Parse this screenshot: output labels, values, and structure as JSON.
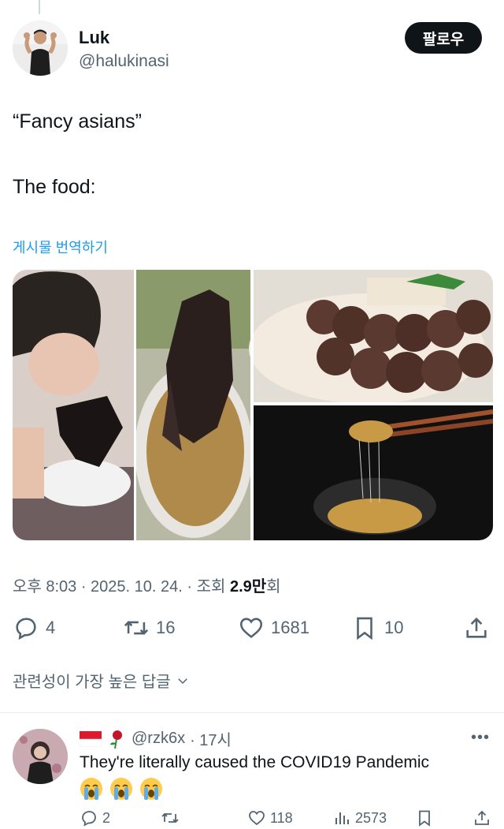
{
  "author": {
    "name": "Luk",
    "handle": "@halukinasi",
    "follow_label": "팔로우"
  },
  "tweet": {
    "line1": "“Fancy asians”",
    "line2": "The food:",
    "translate_label": "게시물 번역하기"
  },
  "meta": {
    "time_date": "오후 8:03 · 2025. 10. 24. · 조회 ",
    "views_count": "2.9만",
    "views_suffix": "회"
  },
  "actions": {
    "replies": "4",
    "reposts": "16",
    "likes": "1681",
    "bookmarks": "10"
  },
  "sort_label": "관련성이 가장 높은 답글",
  "reply": {
    "handle": "@rzk6x",
    "time": "· 17시",
    "text": "They're literally caused the COVID19 Pandemic",
    "actions": {
      "replies": "2",
      "likes": "118",
      "views": "2573"
    }
  },
  "colors": {
    "text": "#0f1419",
    "secondary": "#536471",
    "link": "#1d9bf0"
  }
}
